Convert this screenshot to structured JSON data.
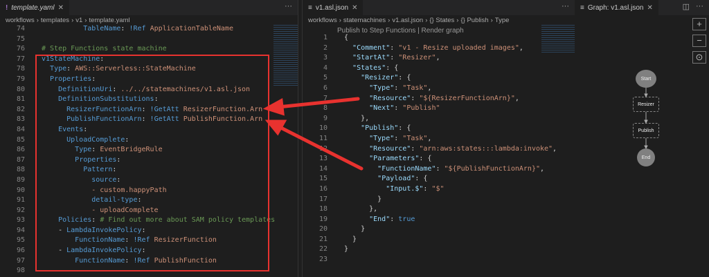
{
  "left": {
    "tab": {
      "icon": "yaml-icon",
      "label": "template.yaml"
    },
    "breadcrumbs": [
      "workflows",
      "templates",
      "v1",
      "template.yaml"
    ],
    "lines": [
      {
        "n": "74",
        "i": 5,
        "tk": [
          [
            "TableName",
            "k"
          ],
          [
            ": ",
            "p"
          ],
          [
            "!Ref",
            "t"
          ],
          [
            " ApplicationTableName",
            "s"
          ]
        ]
      },
      {
        "n": "75",
        "i": 0,
        "tk": []
      },
      {
        "n": "76",
        "i": 0,
        "tk": [
          [
            "# Step Functions state machine",
            "c"
          ]
        ]
      },
      {
        "n": "77",
        "i": 0,
        "tk": [
          [
            "v1StateMachine",
            "k"
          ],
          [
            ":",
            "p"
          ]
        ]
      },
      {
        "n": "78",
        "i": 1,
        "tk": [
          [
            "Type",
            "k"
          ],
          [
            ": ",
            "p"
          ],
          [
            "AWS::Serverless::StateMachine",
            "s"
          ]
        ]
      },
      {
        "n": "79",
        "i": 1,
        "tk": [
          [
            "Properties",
            "k"
          ],
          [
            ":",
            "p"
          ]
        ]
      },
      {
        "n": "80",
        "i": 2,
        "tk": [
          [
            "DefinitionUri",
            "k"
          ],
          [
            ": ",
            "p"
          ],
          [
            "../../statemachines/v1.asl.json",
            "s"
          ]
        ]
      },
      {
        "n": "81",
        "i": 2,
        "tk": [
          [
            "DefinitionSubstitutions",
            "k"
          ],
          [
            ":",
            "p"
          ]
        ]
      },
      {
        "n": "82",
        "i": 3,
        "tk": [
          [
            "ResizerFunctionArn",
            "k"
          ],
          [
            ": ",
            "p"
          ],
          [
            "!GetAtt",
            "t"
          ],
          [
            " ResizerFunction.Arn",
            "s"
          ]
        ]
      },
      {
        "n": "83",
        "i": 3,
        "tk": [
          [
            "PublishFunctionArn",
            "k"
          ],
          [
            ": ",
            "p"
          ],
          [
            "!GetAtt",
            "t"
          ],
          [
            " PublishFunction.Arn",
            "s"
          ]
        ]
      },
      {
        "n": "84",
        "i": 2,
        "tk": [
          [
            "Events",
            "k"
          ],
          [
            ":",
            "p"
          ]
        ]
      },
      {
        "n": "85",
        "i": 3,
        "tk": [
          [
            "UploadComplete",
            "k"
          ],
          [
            ":",
            "p"
          ]
        ]
      },
      {
        "n": "86",
        "i": 4,
        "tk": [
          [
            "Type",
            "k"
          ],
          [
            ": ",
            "p"
          ],
          [
            "EventBridgeRule",
            "s"
          ]
        ]
      },
      {
        "n": "87",
        "i": 4,
        "tk": [
          [
            "Properties",
            "k"
          ],
          [
            ":",
            "p"
          ]
        ]
      },
      {
        "n": "88",
        "i": 5,
        "tk": [
          [
            "Pattern",
            "k"
          ],
          [
            ":",
            "p"
          ]
        ]
      },
      {
        "n": "89",
        "i": 6,
        "tk": [
          [
            "source",
            "k"
          ],
          [
            ":",
            "p"
          ]
        ]
      },
      {
        "n": "90",
        "i": 6,
        "tk": [
          [
            "- custom.happyPath",
            "s"
          ]
        ]
      },
      {
        "n": "91",
        "i": 6,
        "tk": [
          [
            "detail-type",
            "k"
          ],
          [
            ":",
            "p"
          ]
        ]
      },
      {
        "n": "92",
        "i": 6,
        "tk": [
          [
            "- uploadComplete",
            "s"
          ]
        ]
      },
      {
        "n": "93",
        "i": 2,
        "tk": [
          [
            "Policies",
            "k"
          ],
          [
            ": ",
            "p"
          ],
          [
            "# Find out more about SAM policy templates",
            "c"
          ]
        ]
      },
      {
        "n": "94",
        "i": 2,
        "tk": [
          [
            "- ",
            "p"
          ],
          [
            "LambdaInvokePolicy",
            "k"
          ],
          [
            ":",
            "p"
          ]
        ]
      },
      {
        "n": "95",
        "i": 4,
        "tk": [
          [
            "FunctionName",
            "k"
          ],
          [
            ": ",
            "p"
          ],
          [
            "!Ref",
            "t"
          ],
          [
            " ResizerFunction",
            "s"
          ]
        ]
      },
      {
        "n": "96",
        "i": 2,
        "tk": [
          [
            "- ",
            "p"
          ],
          [
            "LambdaInvokePolicy",
            "k"
          ],
          [
            ":",
            "p"
          ]
        ]
      },
      {
        "n": "97",
        "i": 4,
        "tk": [
          [
            "FunctionName",
            "k"
          ],
          [
            ": ",
            "p"
          ],
          [
            "!Ref",
            "t"
          ],
          [
            " PublishFunction",
            "s"
          ]
        ]
      },
      {
        "n": "98",
        "i": 0,
        "tk": []
      }
    ]
  },
  "mid": {
    "tab": {
      "icon": "json-icon",
      "label": "v1.asl.json"
    },
    "breadcrumbs": [
      "workflows",
      "statemachines",
      "v1.asl.json",
      "{} States",
      "{} Publish",
      "Type"
    ],
    "codelens": "Publish to Step Functions | Render graph",
    "lines": [
      {
        "n": "1",
        "i": 0,
        "tk": [
          [
            "{",
            "p"
          ]
        ]
      },
      {
        "n": "2",
        "i": 1,
        "tk": [
          [
            "\"Comment\"",
            "jk"
          ],
          [
            ": ",
            "p"
          ],
          [
            "\"v1 - Resize uploaded images\"",
            "s"
          ],
          [
            ",",
            "p"
          ]
        ]
      },
      {
        "n": "3",
        "i": 1,
        "tk": [
          [
            "\"StartAt\"",
            "jk"
          ],
          [
            ": ",
            "p"
          ],
          [
            "\"Resizer\"",
            "s"
          ],
          [
            ",",
            "p"
          ]
        ]
      },
      {
        "n": "4",
        "i": 1,
        "tk": [
          [
            "\"States\"",
            "jk"
          ],
          [
            ": {",
            "p"
          ]
        ]
      },
      {
        "n": "5",
        "i": 2,
        "tk": [
          [
            "\"Resizer\"",
            "jk"
          ],
          [
            ": {",
            "p"
          ]
        ]
      },
      {
        "n": "6",
        "i": 3,
        "tk": [
          [
            "\"Type\"",
            "jk"
          ],
          [
            ": ",
            "p"
          ],
          [
            "\"Task\"",
            "s"
          ],
          [
            ",",
            "p"
          ]
        ]
      },
      {
        "n": "7",
        "i": 3,
        "tk": [
          [
            "\"Resource\"",
            "jk"
          ],
          [
            ": ",
            "p"
          ],
          [
            "\"${ResizerFunctionArn}\"",
            "s"
          ],
          [
            ",",
            "p"
          ]
        ]
      },
      {
        "n": "8",
        "i": 3,
        "tk": [
          [
            "\"Next\"",
            "jk"
          ],
          [
            ": ",
            "p"
          ],
          [
            "\"Publish\"",
            "s"
          ]
        ]
      },
      {
        "n": "9",
        "i": 2,
        "tk": [
          [
            "},",
            "p"
          ]
        ]
      },
      {
        "n": "10",
        "i": 2,
        "tk": [
          [
            "\"Publish\"",
            "jk"
          ],
          [
            ": {",
            "p"
          ]
        ]
      },
      {
        "n": "11",
        "i": 3,
        "tk": [
          [
            "\"Type\"",
            "jk"
          ],
          [
            ": ",
            "p"
          ],
          [
            "\"Task\"",
            "s"
          ],
          [
            ",",
            "p"
          ]
        ]
      },
      {
        "n": "12",
        "i": 3,
        "tk": [
          [
            "\"Resource\"",
            "jk"
          ],
          [
            ": ",
            "p"
          ],
          [
            "\"arn:aws:states:::lambda:invoke\"",
            "s"
          ],
          [
            ",",
            "p"
          ]
        ]
      },
      {
        "n": "13",
        "i": 3,
        "tk": [
          [
            "\"Parameters\"",
            "jk"
          ],
          [
            ": {",
            "p"
          ]
        ]
      },
      {
        "n": "14",
        "i": 4,
        "tk": [
          [
            "\"FunctionName\"",
            "jk"
          ],
          [
            ": ",
            "p"
          ],
          [
            "\"${PublishFunctionArn}\"",
            "s"
          ],
          [
            ",",
            "p"
          ]
        ]
      },
      {
        "n": "15",
        "i": 4,
        "tk": [
          [
            "\"Payload\"",
            "jk"
          ],
          [
            ": {",
            "p"
          ]
        ]
      },
      {
        "n": "16",
        "i": 5,
        "tk": [
          [
            "\"Input.$\"",
            "jk"
          ],
          [
            ": ",
            "p"
          ],
          [
            "\"$\"",
            "s"
          ]
        ]
      },
      {
        "n": "17",
        "i": 4,
        "tk": [
          [
            "}",
            "p"
          ]
        ]
      },
      {
        "n": "18",
        "i": 3,
        "tk": [
          [
            "},",
            "p"
          ]
        ]
      },
      {
        "n": "19",
        "i": 3,
        "tk": [
          [
            "\"End\"",
            "jk"
          ],
          [
            ": ",
            "p"
          ],
          [
            "true",
            "t"
          ]
        ]
      },
      {
        "n": "20",
        "i": 2,
        "tk": [
          [
            "}",
            "p"
          ]
        ]
      },
      {
        "n": "21",
        "i": 1,
        "tk": [
          [
            "}",
            "p"
          ]
        ]
      },
      {
        "n": "22",
        "i": 0,
        "tk": [
          [
            "}",
            "p"
          ]
        ]
      },
      {
        "n": "23",
        "i": 0,
        "tk": []
      }
    ]
  },
  "right": {
    "tab": {
      "icon": "graph-icon",
      "label": "Graph: v1.asl.json"
    },
    "controls": {
      "zoom_in": "+",
      "zoom_out": "−",
      "center": "⊙"
    },
    "nodes": {
      "start": "Start",
      "resizer": "Resizer",
      "publish": "Publish",
      "end": "End"
    }
  },
  "colors": {
    "highlight": "#e8322f",
    "background": "#1e1e1e"
  }
}
